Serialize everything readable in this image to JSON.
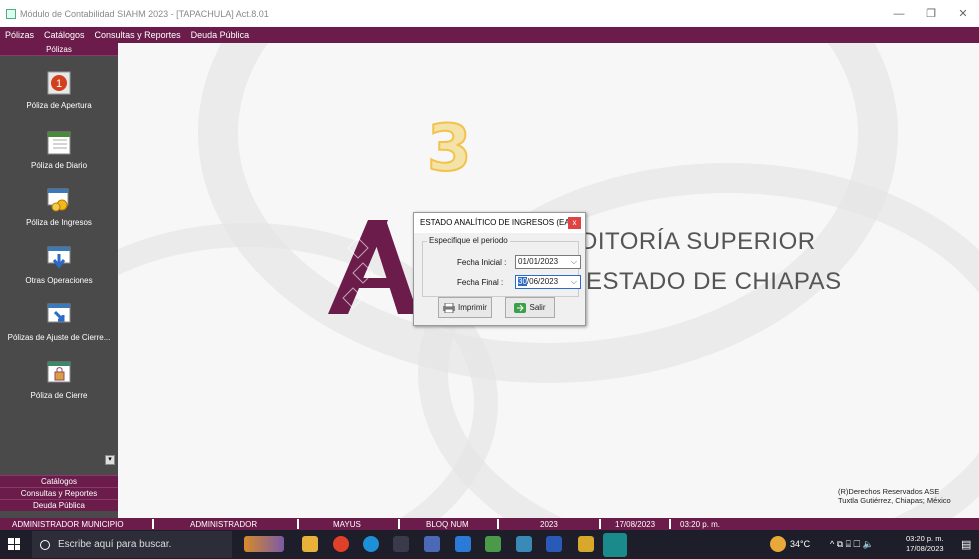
{
  "window": {
    "title": "Módulo de Contabilidad SIAHM 2023 - [TAPACHULA] Act.8.01",
    "minimize": "—",
    "maximize": "❐",
    "close": "✕"
  },
  "menubar": [
    "Pólizas",
    "Catálogos",
    "Consultas y Reportes",
    "Deuda Pública"
  ],
  "sidebar": {
    "header": "Pólizas",
    "items": [
      {
        "label": "Póliza de Apertura",
        "icon": "number-one-icon"
      },
      {
        "label": "Póliza de Diario",
        "icon": "calendar-sheet-icon"
      },
      {
        "label": "Póliza de Ingresos",
        "icon": "coins-icon"
      },
      {
        "label": "Otras Operaciones",
        "icon": "download-arrow-icon"
      },
      {
        "label": "Pólizas de Ajuste de Cierre...",
        "icon": "adjust-arrow-icon"
      },
      {
        "label": "Póliza de Cierre",
        "icon": "lock-icon"
      }
    ],
    "scroll_glyph": "▾",
    "bottom_sections": [
      "Catálogos",
      "Consultas y Reportes",
      "Deuda Pública"
    ]
  },
  "workspace": {
    "step_number": "3",
    "logo_line1": "DITORÍA SUPERIOR",
    "logo_line2": "ESTADO DE CHIAPAS",
    "copyright_line1": "(R)Derechos Reservados ASE",
    "copyright_line2": "Tuxtla Gutiérrez, Chiapas; México"
  },
  "dialog": {
    "title": "ESTADO ANALÍTICO DE INGRESOS (EA...",
    "close": "x",
    "group_label": "Especifique el periodo",
    "fecha_inicial_label": "Fecha Inicial :",
    "fecha_inicial_value": "01/01/2023",
    "fecha_final_label": "Fecha Final :",
    "fecha_final_day": "30",
    "fecha_final_rest": "/06/2023",
    "chevron": "⌵",
    "imprimir_label": "Imprimir",
    "salir_label": "Salir"
  },
  "statusbar": {
    "user": "ADMINISTRADOR MUNICIPIO",
    "role": "ADMINISTRADOR",
    "caps": "MAYUS",
    "num": "BLOQ NUM",
    "year": "2023",
    "date": "17/08/2023",
    "time": "03:20 p. m."
  },
  "taskbar": {
    "search_placeholder": "Escribe aquí para buscar.",
    "temperature": "34°C",
    "clock_time": "03:20 p. m.",
    "clock_date": "17/08/2023",
    "tray_glyphs": "^ ⧉ ⌸ ☐ 🔈",
    "notification_glyph": "▤"
  },
  "colors": {
    "brand": "#6b1c4a",
    "sidebar_bg": "#4a4a4a",
    "accent_yellow": "#f3c24a"
  }
}
